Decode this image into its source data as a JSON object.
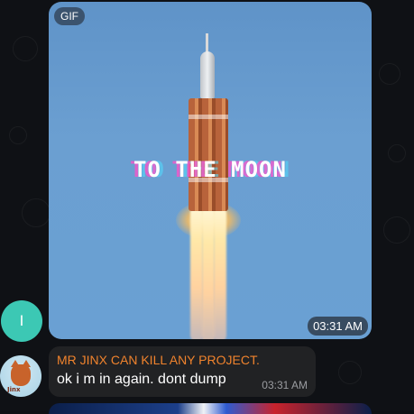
{
  "gif_message": {
    "badge": "GIF",
    "caption": "TO THE MOON",
    "time": "03:31 AM"
  },
  "sender_avatar_letter": "I",
  "text_message": {
    "sender": "MR JINX CAN KILL ANY PROJECT.",
    "text": "ok i m in again.  dont dump",
    "time": "03:31 AM",
    "avatar_label": "Jinx"
  },
  "colors": {
    "sender_name": "#f0832d",
    "avatar_letter_bg": "#3cc8b4",
    "bubble_bg": "#212224"
  }
}
